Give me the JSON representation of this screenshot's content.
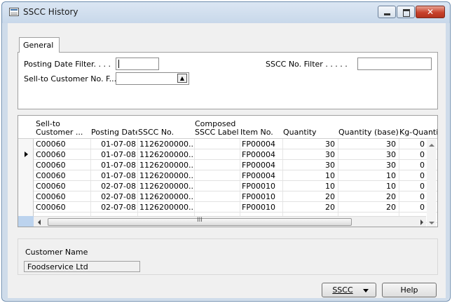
{
  "window": {
    "title": "SSCC History"
  },
  "tabs": [
    {
      "label": "General"
    }
  ],
  "filters": {
    "posting_date_label": "Posting Date Filter. . . .",
    "posting_date_value": "",
    "customer_label": "Sell-to Customer No. F...",
    "customer_value": "",
    "sscc_label": "SSCC No. Filter . . . . .",
    "sscc_value": ""
  },
  "table": {
    "columns": {
      "customer": [
        "Sell-to",
        "Customer ..."
      ],
      "posting_date": "Posting Date",
      "sscc_no": "SSCC No.",
      "composed": [
        "Composed",
        "SSCC Label"
      ],
      "item_no": "Item No.",
      "quantity": "Quantity",
      "quantity_base": "Quantity (base)",
      "kg_quantity": "Kg-Quantity"
    },
    "rows": [
      {
        "customer": "C00060",
        "posting_date": "01-07-08",
        "sscc_no": "1126200000...",
        "composed": "",
        "item_no": "FP00004",
        "quantity": "30",
        "quantity_base": "30",
        "kg_quantity": "0"
      },
      {
        "customer": "C00060",
        "posting_date": "01-07-08",
        "sscc_no": "1126200000...",
        "composed": "",
        "item_no": "FP00004",
        "quantity": "30",
        "quantity_base": "30",
        "kg_quantity": "0"
      },
      {
        "customer": "C00060",
        "posting_date": "01-07-08",
        "sscc_no": "1126200000...",
        "composed": "",
        "item_no": "FP00004",
        "quantity": "30",
        "quantity_base": "30",
        "kg_quantity": "0"
      },
      {
        "customer": "C00060",
        "posting_date": "01-07-08",
        "sscc_no": "1126200000...",
        "composed": "",
        "item_no": "FP00004",
        "quantity": "10",
        "quantity_base": "10",
        "kg_quantity": "0"
      },
      {
        "customer": "C00060",
        "posting_date": "02-07-08",
        "sscc_no": "1126200000...",
        "composed": "",
        "item_no": "FP00010",
        "quantity": "10",
        "quantity_base": "10",
        "kg_quantity": "0"
      },
      {
        "customer": "C00060",
        "posting_date": "02-07-08",
        "sscc_no": "1126200000...",
        "composed": "",
        "item_no": "FP00010",
        "quantity": "20",
        "quantity_base": "20",
        "kg_quantity": "0"
      },
      {
        "customer": "C00060",
        "posting_date": "02-07-08",
        "sscc_no": "1126200000...",
        "composed": "",
        "item_no": "FP00010",
        "quantity": "20",
        "quantity_base": "20",
        "kg_quantity": "0"
      }
    ],
    "scroll_grip": "III"
  },
  "info": {
    "customer_name_label": "Customer Name",
    "customer_name_value": "Foodservice Ltd"
  },
  "buttons": {
    "sscc_label": "SSCC",
    "help_label": "Help"
  },
  "icons": {
    "window": "table-window-icon",
    "lookup": "lookup-arrow-icon",
    "minimize": "minimize-icon",
    "maximize": "maximize-icon",
    "close": "close-icon"
  },
  "colors": {
    "titlebar": "#cfdcea",
    "close_button": "#c8422c",
    "selection_blue": "#bcd3ee"
  }
}
